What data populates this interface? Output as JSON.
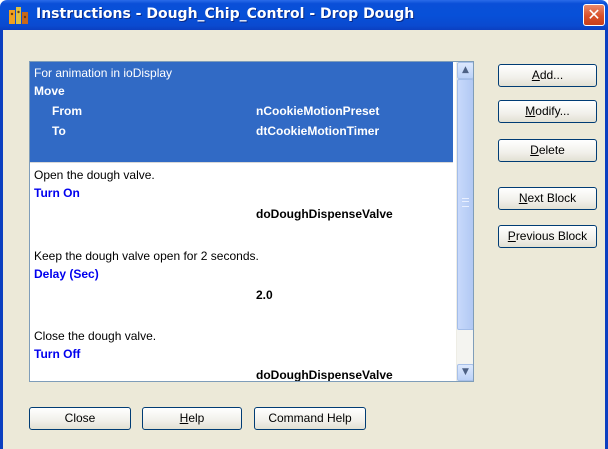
{
  "window": {
    "title": "Instructions - Dough_Chip_Control - Drop Dough",
    "close_glyph": "✕"
  },
  "list": {
    "blocks": [
      {
        "comment": "For animation in ioDisplay",
        "command": "Move",
        "params": [
          {
            "label": "From",
            "value": "nCookieMotionPreset"
          },
          {
            "label": "To",
            "value": "dtCookieMotionTimer"
          }
        ],
        "selected": true
      },
      {
        "comment": "Open the dough valve.",
        "command": "Turn On",
        "value": "doDoughDispenseValve"
      },
      {
        "comment": "Keep the dough valve open for 2 seconds.",
        "command": "Delay (Sec)",
        "value": "2.0"
      },
      {
        "comment": "Close the dough valve.",
        "command": "Turn Off",
        "value": "doDoughDispenseValve"
      }
    ]
  },
  "scrollbar": {
    "up_glyph": "▲",
    "down_glyph": "▼",
    "position_fraction": 0.0
  },
  "buttons": {
    "add": {
      "mnemonic": "A",
      "rest": "dd..."
    },
    "modify": {
      "mnemonic": "M",
      "rest": "odify..."
    },
    "delete": {
      "mnemonic": "D",
      "rest": "elete"
    },
    "next_block": {
      "mnemonic": "N",
      "rest": "ext Block"
    },
    "previous_block": {
      "mnemonic": "P",
      "rest": "revious Block"
    },
    "close": {
      "label": "Close"
    },
    "help": {
      "mnemonic": "H",
      "rest": "elp"
    },
    "command_help": {
      "label": "Command Help"
    }
  },
  "colors": {
    "titlebar": "#0a4fd8",
    "selection": "#316ac5",
    "command_text": "#0000ee",
    "dialog_bg": "#ece9d8"
  }
}
